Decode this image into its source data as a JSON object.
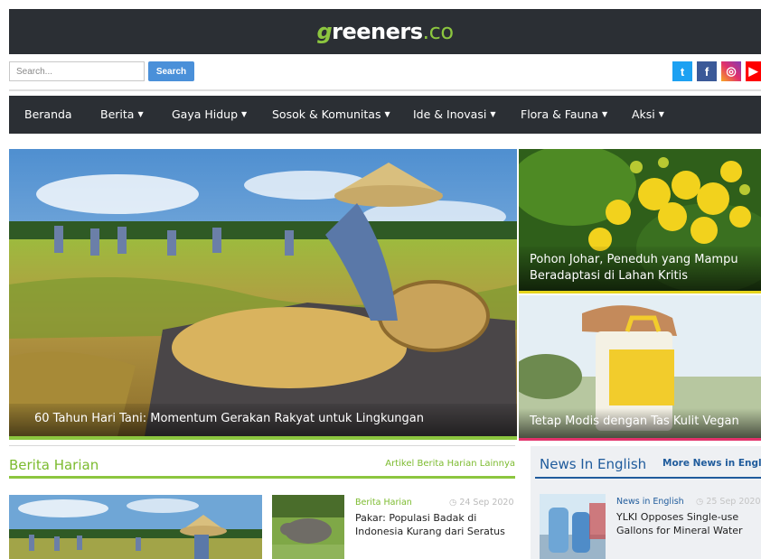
{
  "header": {
    "logo_g": "g",
    "logo_main": "reeners",
    "logo_tld": ".co"
  },
  "search": {
    "placeholder": "Search...",
    "button_label": "Search"
  },
  "social": {
    "twitter": "t",
    "facebook": "f",
    "instagram": "◎",
    "youtube": "▶"
  },
  "nav": {
    "items": [
      {
        "label": "Beranda",
        "dropdown": false
      },
      {
        "label": "Berita",
        "dropdown": true
      },
      {
        "label": "Gaya Hidup",
        "dropdown": true
      },
      {
        "label": "Sosok & Komunitas",
        "dropdown": true
      },
      {
        "label": "Ide & Inovasi",
        "dropdown": true
      },
      {
        "label": "Flora & Fauna",
        "dropdown": true
      },
      {
        "label": "Aksi",
        "dropdown": true
      }
    ],
    "caret": "▼"
  },
  "featured": {
    "main_caption": "60 Tahun Hari Tani: Momentum Gerakan Rakyat untuk Lingkungan",
    "side_1_caption": "Pohon Johar, Peneduh yang Mampu Beradaptasi di Lahan Kritis",
    "side_2_caption": "Tetap Modis dengan Tas Kulit Vegan"
  },
  "berita_harian": {
    "title": "Berita Harian",
    "more_link": "Artikel Berita Harian Lainnya",
    "article": {
      "category": "Berita Harian",
      "date": "24 Sep 2020",
      "title": "Pakar: Populasi Badak di Indonesia Kurang dari Seratus"
    }
  },
  "news_in_english": {
    "title": "News In English",
    "more_link": "More News in English",
    "article": {
      "category": "News in English",
      "date": "25 Sep 2020",
      "title": "YLKI Opposes Single-use Gallons for Mineral Water"
    }
  },
  "colors": {
    "dark_bar": "#2b2f34",
    "green_accent": "#8cc63f",
    "blue_accent": "#1f5b9c",
    "search_button": "#4a90d9",
    "pink_bar": "#e2336b"
  }
}
